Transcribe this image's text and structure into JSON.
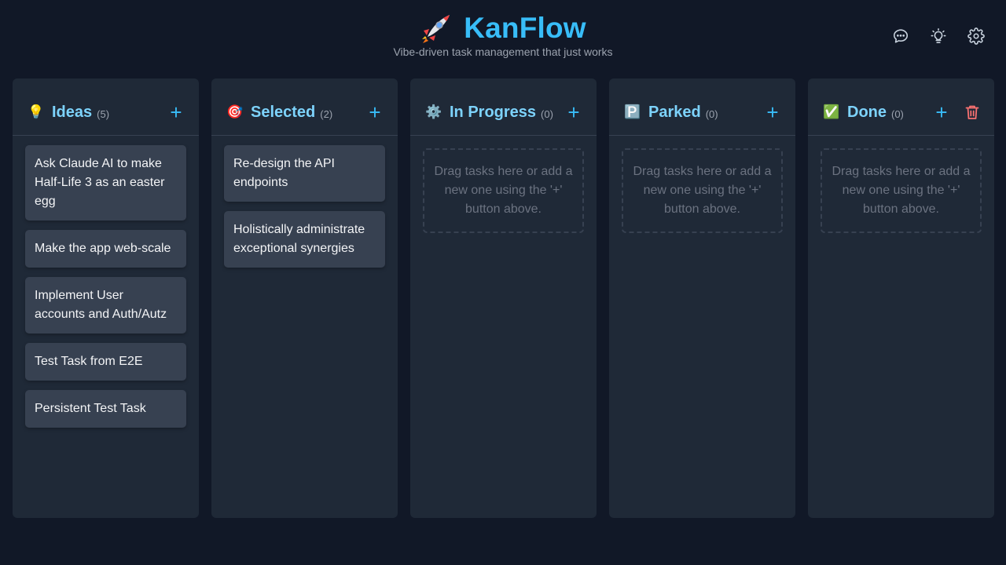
{
  "app": {
    "title": "KanFlow",
    "tagline": "Vibe-driven task management that just works"
  },
  "header_actions": [
    {
      "icon": "chat-bubble-icon"
    },
    {
      "icon": "lightbulb-icon"
    },
    {
      "icon": "gear-icon"
    }
  ],
  "colors": {
    "background": "#111827",
    "column": "#1f2937",
    "card": "#374151",
    "accent": "#38bdf8",
    "column_title": "#7dd3fc",
    "danger": "#f87171"
  },
  "columns": [
    {
      "id": "ideas",
      "icon": "lightbulb-icon",
      "icon_glyph": "💡",
      "title": "Ideas",
      "count": "(5)",
      "add_label": "+",
      "cards": [
        "Ask Claude AI to make Half-Life 3 as an easter egg",
        "Make the app web-scale",
        "Implement User accounts and Auth/Autz",
        "Test Task from E2E",
        "Persistent Test Task"
      ]
    },
    {
      "id": "selected",
      "icon": "target-icon",
      "icon_glyph": "🎯",
      "title": "Selected",
      "count": "(2)",
      "add_label": "+",
      "cards": [
        "Re-design the API endpoints",
        "Holistically administrate exceptional synergies"
      ]
    },
    {
      "id": "in-progress",
      "icon": "gear-icon",
      "icon_glyph": "⚙️",
      "title": "In Progress",
      "count": "(0)",
      "add_label": "+",
      "empty_text": "Drag tasks here or add a new one using the '+' button above.",
      "cards": []
    },
    {
      "id": "parked",
      "icon": "parking-icon",
      "icon_glyph": "🅿️",
      "title": "Parked",
      "count": "(0)",
      "add_label": "+",
      "empty_text": "Drag tasks here or add a new one using the '+' button above.",
      "cards": []
    },
    {
      "id": "done",
      "icon": "check-mark-icon",
      "icon_glyph": "✅",
      "title": "Done",
      "count": "(0)",
      "add_label": "+",
      "has_trash": true,
      "empty_text": "Drag tasks here or add a new one using the '+' button above.",
      "cards": []
    }
  ]
}
